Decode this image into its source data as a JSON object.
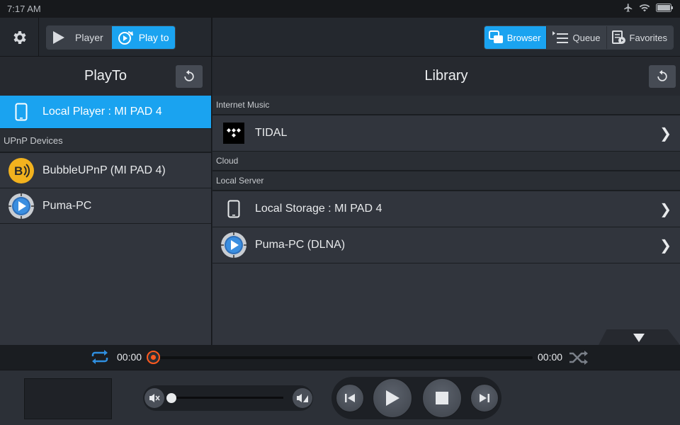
{
  "status_bar": {
    "time": "7:17  AM"
  },
  "toolbar": {
    "player_label": "Player",
    "playto_label": "Play to",
    "browser_label": "Browser",
    "queue_label": "Queue",
    "favorites_label": "Favorites"
  },
  "playto_panel": {
    "title": "PlayTo",
    "selected_renderer": "Local Player : MI PAD 4",
    "upnp_section": "UPnP Devices",
    "devices": [
      {
        "label": "BubbleUPnP (MI PAD 4)",
        "icon": "bubbleupnp-icon"
      },
      {
        "label": "Puma-PC",
        "icon": "dlna-play-icon"
      }
    ]
  },
  "library_panel": {
    "title": "Library",
    "sections": {
      "internet_music": "Internet Music",
      "cloud": "Cloud",
      "local_server": "Local Server"
    },
    "internet_music_items": [
      {
        "label": "TIDAL",
        "icon": "tidal-icon"
      }
    ],
    "local_server_items": [
      {
        "label": "Local Storage : MI PAD 4",
        "icon": "tablet-icon"
      },
      {
        "label": "Puma-PC (DLNA)",
        "icon": "dlna-play-icon"
      }
    ]
  },
  "playback": {
    "elapsed": "00:00",
    "duration": "00:00",
    "progress": 0,
    "volume": 0
  },
  "colors": {
    "accent": "#1aa3f0",
    "seek_thumb": "#ff5a1f",
    "panel_bg": "#31353d"
  }
}
